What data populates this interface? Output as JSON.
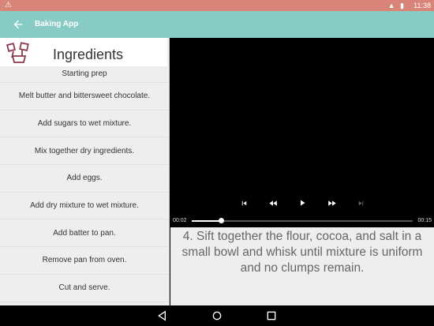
{
  "status_bar": {
    "warning_icon": "warning-icon",
    "icons": "▲ ▮",
    "time": "11:38"
  },
  "app_bar": {
    "back_icon": "arrow-back-icon",
    "title": "Baking App"
  },
  "ingredients": {
    "icon": "ingredients-icon",
    "label": "Ingredients"
  },
  "steps": [
    "Starting prep",
    "Melt butter and bittersweet chocolate.",
    "Add sugars to wet mixture.",
    "Mix together dry ingredients.",
    "Add eggs.",
    "Add dry mixture to wet mixture.",
    "Add batter to pan.",
    "Remove pan from oven.",
    "Cut and serve."
  ],
  "player": {
    "current_time": "00:02",
    "duration": "00:15",
    "progress_fraction": 0.133,
    "controls": [
      "skip-previous-icon",
      "rewind-icon",
      "play-icon",
      "fast-forward-icon",
      "skip-next-icon"
    ]
  },
  "description": "4. Sift together the flour, cocoa, and salt in a small bowl and whisk until mixture is uniform and no clumps remain.",
  "nav_bar": [
    "back-triangle-icon",
    "home-circle-icon",
    "recents-square-icon"
  ],
  "colors": {
    "status_bar": "#d98479",
    "app_bar": "#87cbc4",
    "sidebar": "#eeeeee",
    "ingredients_icon": "#8b3a4e"
  }
}
